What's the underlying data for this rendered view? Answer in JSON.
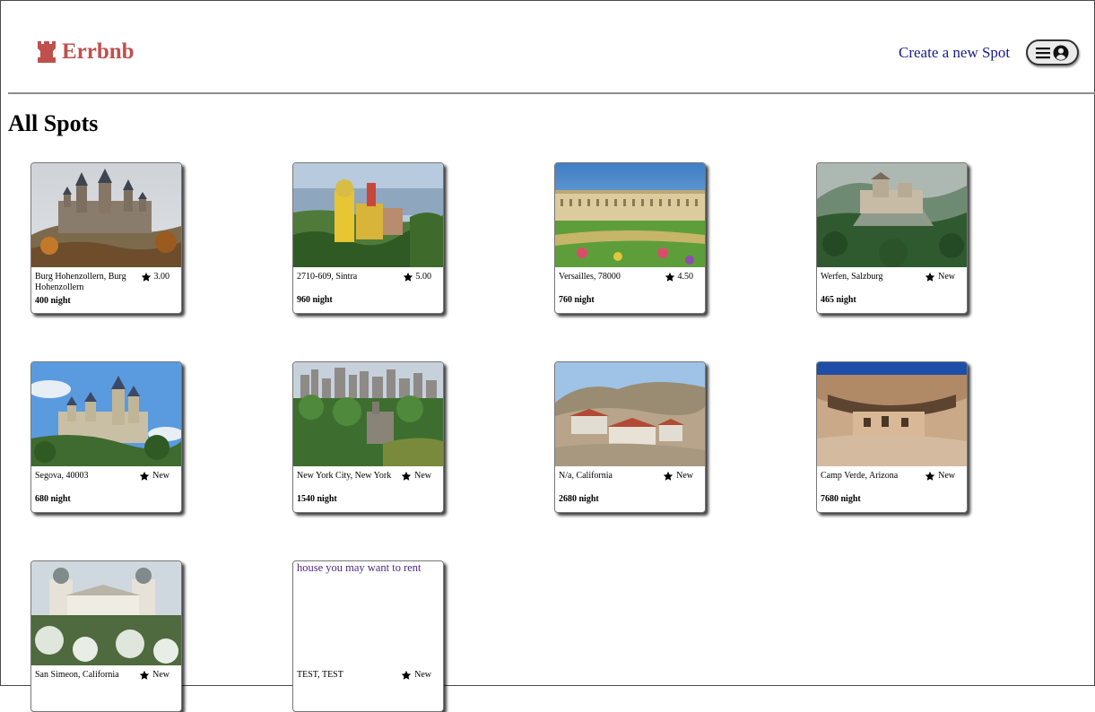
{
  "header": {
    "brand": "Errbnb",
    "create_link": "Create a new Spot",
    "accent_color": "#c0504d"
  },
  "page_title": "All Spots",
  "spots": [
    {
      "location": "Burg Hohenzollern, Burg Hohenzollern",
      "rating": "3.00",
      "price": "400 night",
      "image": "castle-on-hill"
    },
    {
      "location": "2710-609, Sintra",
      "rating": "5.00",
      "price": "960 night",
      "image": "yellow-palace"
    },
    {
      "location": "Versailles, 78000",
      "rating": "4.50",
      "price": "760 night",
      "image": "palace-gardens"
    },
    {
      "location": "Werfen, Salzburg",
      "rating": "New",
      "price": "465 night",
      "image": "fortress-forest"
    },
    {
      "location": "Segova, 40003",
      "rating": "New",
      "price": "680 night",
      "image": "alcazar"
    },
    {
      "location": "New York City, New York",
      "rating": "New",
      "price": "1540 night",
      "image": "city-park-castle"
    },
    {
      "location": "N/a, California",
      "rating": "New",
      "price": "2680 night",
      "image": "desert-villa"
    },
    {
      "location": "Camp Verde, Arizona",
      "rating": "New",
      "price": "7680 night",
      "image": "cliff-dwelling"
    },
    {
      "location": "San Simeon, California",
      "rating": "New",
      "price": "",
      "image": "hearst-castle"
    },
    {
      "location": "TEST, TEST",
      "rating": "New",
      "price": "",
      "image": "broken",
      "image_alt": "house you may want to rent"
    }
  ]
}
